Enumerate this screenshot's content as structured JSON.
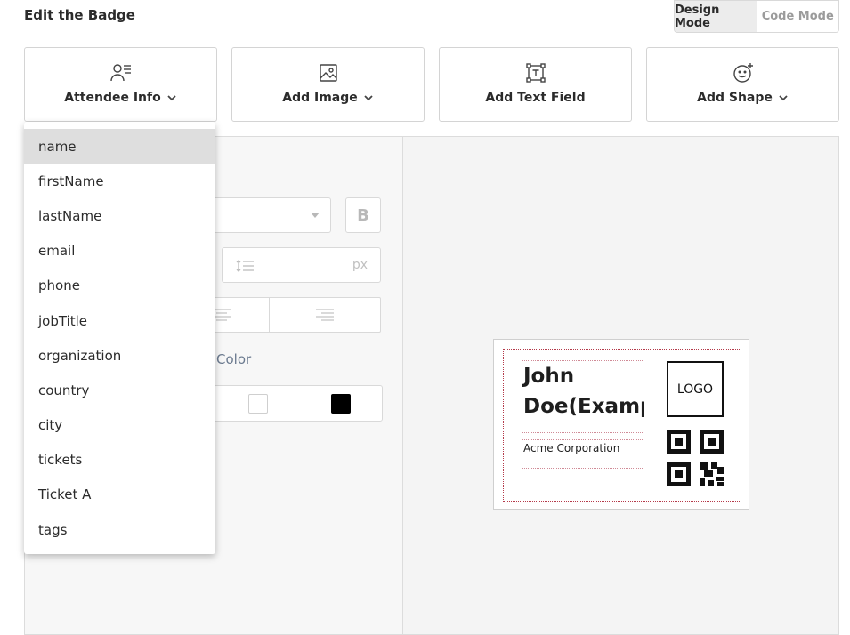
{
  "header": {
    "title": "Edit the Badge"
  },
  "mode_toggle": {
    "design": "Design Mode",
    "code": "Code Mode",
    "active": "design"
  },
  "toolbar": {
    "attendee_info": "Attendee Info",
    "add_image": "Add Image",
    "add_text_field": "Add Text Field",
    "add_shape": "Add Shape"
  },
  "dropdown": {
    "items": [
      "name",
      "firstName",
      "lastName",
      "email",
      "phone",
      "jobTitle",
      "organization",
      "country",
      "city",
      "tickets",
      "Ticket A",
      "tags"
    ],
    "selected": "name"
  },
  "properties": {
    "bold_label": "B",
    "line_height_unit": "px",
    "color_label": "Color",
    "swatches": [
      "#ffffff",
      "#000000"
    ]
  },
  "badge": {
    "name": "John Doe(Example)",
    "organization": "Acme Corporation",
    "logo": "LOGO"
  },
  "colors": {
    "accent_border": "#b53a4a",
    "selected_bg": "#dedede"
  }
}
